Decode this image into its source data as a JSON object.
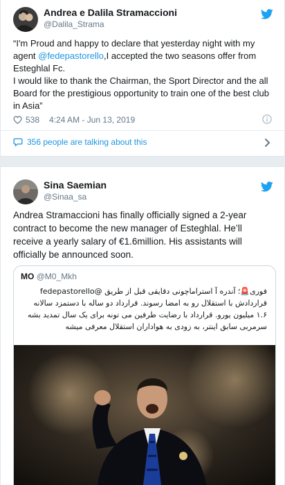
{
  "tweet1": {
    "author_name": "Andrea e Dalila Stramaccioni",
    "author_handle": "@Dalila_Strama",
    "text_before_mention": "“I'm Proud and happy to declare that  yesterday night with my agent ",
    "mention": "@fedepastorello",
    "text_after_mention": ",I accepted the two seasons offer from Esteghlal Fc.\nI would like to thank the Chairman, the Sport Director and the all Board for the prestigious opportunity to train one of the best club in Asia”",
    "likes": "538",
    "timestamp": "4:24 AM - Jun 13, 2019",
    "talking": "356 people are talking about this"
  },
  "tweet2": {
    "author_name": "Sina Saemian",
    "author_handle": "@Sinaa_sa",
    "text": "Andrea Stramaccioni has finally officially signed a 2-year contract to become the new manager of Esteghlal. He’ll receive a yearly salary of €1.6million. His assistants will officially be announced soon.",
    "quote": {
      "author_name": "MO",
      "author_handle": "@M0_Mkh",
      "text": "فوری🚨؛ آندره آ استراماچونی دقایقی قبل از طریق @fedepastorello قراردادش با استقلال رو به امضا رسوند. قرارداد دو ساله با دستمزد سالانه ۱.۶ میلیون یورو. قرارداد با رضایت طرفین می تونه برای یک سال تمدید بشه\nسرمربی سابق اینتر، به زودی به هواداران استقلال معرفی میشه"
    }
  },
  "colors": {
    "twitter_blue": "#1da1f2",
    "link_blue": "#1b95e0",
    "secondary_text": "#657786",
    "background": "#e6ecf0"
  },
  "icons": [
    "twitter-bird-icon",
    "heart-icon",
    "info-icon",
    "comment-bubble-icon",
    "chevron-right-icon"
  ]
}
